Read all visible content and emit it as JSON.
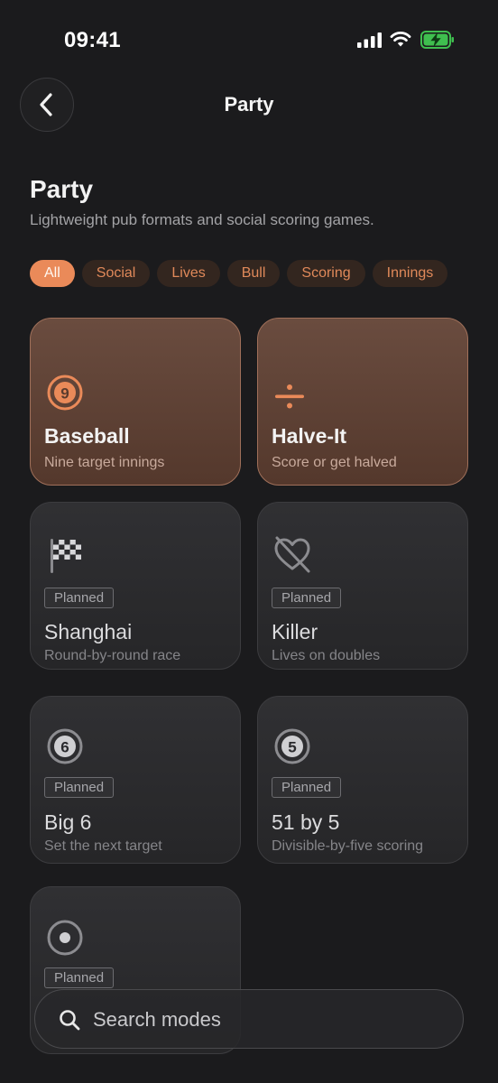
{
  "status_bar": {
    "time": "09:41",
    "icons": [
      "signal-icon",
      "wifi-icon",
      "battery-charging-icon"
    ]
  },
  "nav": {
    "back_icon": "chevron-left-icon",
    "title": "Party"
  },
  "header": {
    "title": "Party",
    "subtitle": "Lightweight pub formats and social scoring games."
  },
  "filters": {
    "chips": [
      {
        "label": "All",
        "selected": true
      },
      {
        "label": "Social",
        "selected": false
      },
      {
        "label": "Lives",
        "selected": false
      },
      {
        "label": "Bull",
        "selected": false
      },
      {
        "label": "Scoring",
        "selected": false
      },
      {
        "label": "Innings",
        "selected": false
      }
    ]
  },
  "modes": [
    {
      "name": "Baseball",
      "desc": "Nine target innings",
      "icon": "number-9-circle-icon",
      "status": ""
    },
    {
      "name": "Halve-It",
      "desc": "Score or get halved",
      "icon": "divide-icon",
      "status": ""
    },
    {
      "name": "Shanghai",
      "desc": "Round-by-round race",
      "icon": "checkered-flag-icon",
      "status": "Planned"
    },
    {
      "name": "Killer",
      "desc": "Lives on doubles",
      "icon": "heart-slash-icon",
      "status": "Planned"
    },
    {
      "name": "Big 6",
      "desc": "Set the next target",
      "icon": "number-6-circle-icon",
      "status": "Planned"
    },
    {
      "name": "51 by 5",
      "desc": "Divisible-by-five scoring",
      "icon": "number-5-circle-icon",
      "status": "Planned"
    },
    {
      "name": "",
      "desc": "",
      "icon": "target-icon",
      "status": "Planned"
    }
  ],
  "search": {
    "placeholder": "Search modes",
    "value": ""
  },
  "colors": {
    "accent": "#ea8a59",
    "background": "#1b1b1d",
    "card": "#2b2b2e",
    "card_featured": "#5e4235"
  }
}
